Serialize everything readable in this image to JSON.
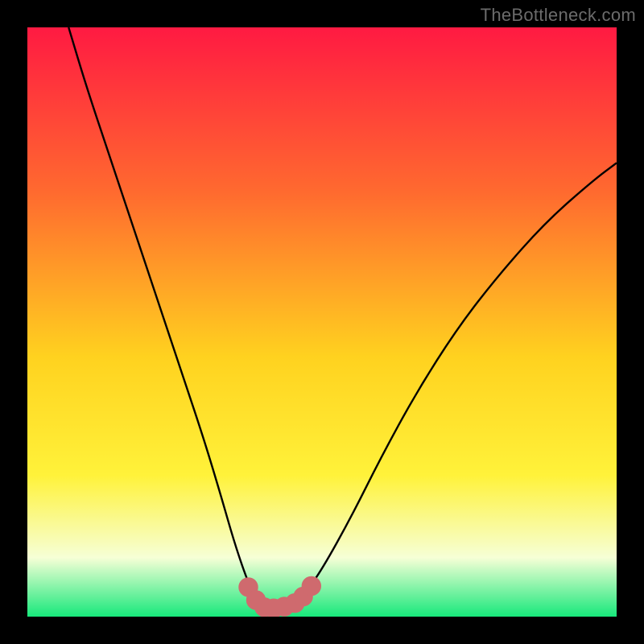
{
  "watermark": "TheBottleneck.com",
  "colors": {
    "frame": "#000000",
    "watermark": "#6b6b6b",
    "curve": "#000000",
    "marker_fill": "#cf6a6e",
    "marker_stroke": "#cf6a6e",
    "gradient_top": "#ff1a42",
    "gradient_mid1": "#ff6a2f",
    "gradient_mid2": "#ffd21f",
    "gradient_mid3": "#fff23a",
    "gradient_pale": "#f6ffd6",
    "gradient_bottom": "#17e87b"
  },
  "chart_data": {
    "type": "line",
    "title": "",
    "xlabel": "",
    "ylabel": "",
    "xlim": [
      0,
      100
    ],
    "ylim": [
      0,
      100
    ],
    "series": [
      {
        "name": "bottleneck-curve",
        "x": [
          7,
          10,
          14,
          18,
          22,
          26,
          30,
          33,
          35,
          37,
          38.5,
          40,
          41.5,
          43,
          45,
          47,
          50,
          55,
          60,
          66,
          73,
          80,
          88,
          96,
          100
        ],
        "y": [
          100,
          90,
          78,
          66,
          54,
          42,
          30,
          20,
          13,
          7,
          3.5,
          1.8,
          1.4,
          1.5,
          2.2,
          3.8,
          8,
          17,
          27,
          38,
          49,
          58,
          67,
          74,
          77
        ]
      }
    ],
    "markers": {
      "name": "valley-markers",
      "points": [
        {
          "x": 37.5,
          "y": 5.0
        },
        {
          "x": 38.8,
          "y": 2.8
        },
        {
          "x": 40.2,
          "y": 1.6
        },
        {
          "x": 41.8,
          "y": 1.4
        },
        {
          "x": 43.6,
          "y": 1.7
        },
        {
          "x": 45.4,
          "y": 2.3
        },
        {
          "x": 46.8,
          "y": 3.4
        },
        {
          "x": 48.2,
          "y": 5.2
        }
      ],
      "radius_data_units": 1.6
    }
  }
}
